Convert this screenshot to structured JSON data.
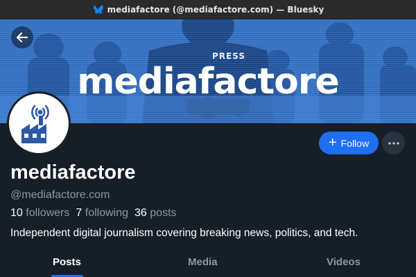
{
  "window": {
    "title": "mediafactore (@mediafactore.com) — Bluesky",
    "app_icon": "butterfly-icon"
  },
  "banner": {
    "headline": "mediafactore",
    "vest_text": "PRESS",
    "color": "#2a65b8"
  },
  "profile": {
    "display_name": "mediafactore",
    "handle": "@mediafactore.com",
    "bio": "Independent digital journalism covering breaking news, politics, and tech.",
    "avatar_icon": "factory-broadcast-icon"
  },
  "stats": {
    "followers_count": "10",
    "followers_label": "followers",
    "following_count": "7",
    "following_label": "following",
    "posts_count": "36",
    "posts_label": "posts"
  },
  "actions": {
    "follow_label": "Follow",
    "more_icon": "ellipsis-icon",
    "back_icon": "arrow-left-icon"
  },
  "tabs": [
    {
      "label": "Posts",
      "active": true
    },
    {
      "label": "Media",
      "active": false
    },
    {
      "label": "Videos",
      "active": false
    }
  ],
  "colors": {
    "accent": "#1f6ff0",
    "background": "#161e27",
    "muted_text": "#8b98a8"
  }
}
